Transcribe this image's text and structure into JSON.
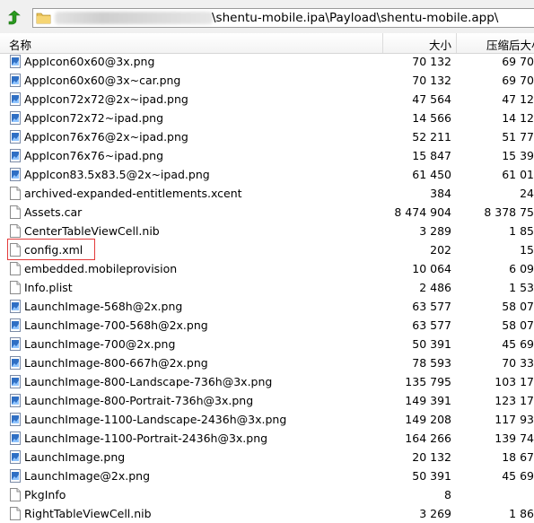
{
  "toolbar": {
    "up_icon": "green-up-arrow-icon"
  },
  "address": {
    "path": "\\shentu-mobile.ipa\\Payload\\shentu-mobile.app\\",
    "folder_icon": "folder-icon"
  },
  "columns": {
    "name": "名称",
    "size": "大小",
    "compressed": "压缩后大小"
  },
  "files": [
    {
      "name": "AppIcon60x60@3x.png",
      "size": "70 132",
      "compressed": "69 70",
      "type": "image"
    },
    {
      "name": "AppIcon60x60@3x~car.png",
      "size": "70 132",
      "compressed": "69 70",
      "type": "image"
    },
    {
      "name": "AppIcon72x72@2x~ipad.png",
      "size": "47 564",
      "compressed": "47 12",
      "type": "image"
    },
    {
      "name": "AppIcon72x72~ipad.png",
      "size": "14 566",
      "compressed": "14 12",
      "type": "image"
    },
    {
      "name": "AppIcon76x76@2x~ipad.png",
      "size": "52 211",
      "compressed": "51 77",
      "type": "image"
    },
    {
      "name": "AppIcon76x76~ipad.png",
      "size": "15 847",
      "compressed": "15 39",
      "type": "image"
    },
    {
      "name": "AppIcon83.5x83.5@2x~ipad.png",
      "size": "61 450",
      "compressed": "61 01",
      "type": "image"
    },
    {
      "name": "archived-expanded-entitlements.xcent",
      "size": "384",
      "compressed": "24",
      "type": "file"
    },
    {
      "name": "Assets.car",
      "size": "8 474 904",
      "compressed": "8 378 75",
      "type": "file"
    },
    {
      "name": "CenterTableViewCell.nib",
      "size": "3 289",
      "compressed": "1 85",
      "type": "file"
    },
    {
      "name": "config.xml",
      "size": "202",
      "compressed": "15",
      "type": "file"
    },
    {
      "name": "embedded.mobileprovision",
      "size": "10 064",
      "compressed": "6 09",
      "type": "file"
    },
    {
      "name": "Info.plist",
      "size": "2 486",
      "compressed": "1 53",
      "type": "file"
    },
    {
      "name": "LaunchImage-568h@2x.png",
      "size": "63 577",
      "compressed": "58 07",
      "type": "image"
    },
    {
      "name": "LaunchImage-700-568h@2x.png",
      "size": "63 577",
      "compressed": "58 07",
      "type": "image"
    },
    {
      "name": "LaunchImage-700@2x.png",
      "size": "50 391",
      "compressed": "45 69",
      "type": "image"
    },
    {
      "name": "LaunchImage-800-667h@2x.png",
      "size": "78 593",
      "compressed": "70 33",
      "type": "image"
    },
    {
      "name": "LaunchImage-800-Landscape-736h@3x.png",
      "size": "135 795",
      "compressed": "103 17",
      "type": "image"
    },
    {
      "name": "LaunchImage-800-Portrait-736h@3x.png",
      "size": "149 391",
      "compressed": "123 17",
      "type": "image"
    },
    {
      "name": "LaunchImage-1100-Landscape-2436h@3x.png",
      "size": "149 208",
      "compressed": "117 93",
      "type": "image"
    },
    {
      "name": "LaunchImage-1100-Portrait-2436h@3x.png",
      "size": "164 266",
      "compressed": "139 74",
      "type": "image"
    },
    {
      "name": "LaunchImage.png",
      "size": "20 132",
      "compressed": "18 67",
      "type": "image"
    },
    {
      "name": "LaunchImage@2x.png",
      "size": "50 391",
      "compressed": "45 69",
      "type": "image"
    },
    {
      "name": "PkgInfo",
      "size": "8",
      "compressed": "",
      "type": "file"
    },
    {
      "name": "RightTableViewCell.nib",
      "size": "3 269",
      "compressed": "1 86",
      "type": "file"
    }
  ],
  "highlight_color": "#e33a3a"
}
